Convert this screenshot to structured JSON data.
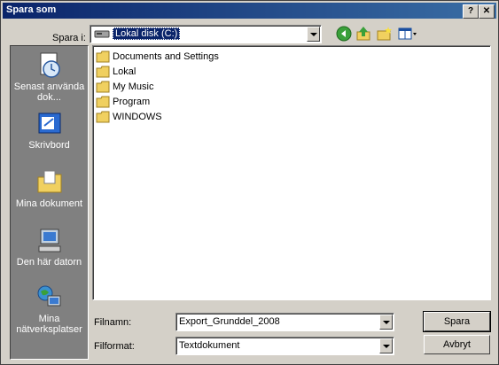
{
  "window": {
    "title": "Spara som",
    "help_label": "?",
    "close_label": "✕"
  },
  "save_in": {
    "label": "Spara i:",
    "value": "Lokal disk (C:)"
  },
  "places": [
    {
      "label": "Senast använda dok...",
      "icon": "recent-documents-icon"
    },
    {
      "label": "Skrivbord",
      "icon": "desktop-icon"
    },
    {
      "label": "Mina dokument",
      "icon": "my-documents-icon"
    },
    {
      "label": "Den här datorn",
      "icon": "my-computer-icon"
    },
    {
      "label": "Mina nätverksplatser",
      "icon": "network-places-icon"
    }
  ],
  "files": [
    {
      "name": "Documents and Settings"
    },
    {
      "name": "Lokal"
    },
    {
      "name": "My Music"
    },
    {
      "name": "Program"
    },
    {
      "name": "WINDOWS"
    }
  ],
  "filename": {
    "label": "Filnamn:",
    "value": "Export_Grunddel_2008"
  },
  "filetype": {
    "label": "Filformat:",
    "value": "Textdokument"
  },
  "buttons": {
    "save": "Spara",
    "cancel": "Avbryt"
  },
  "colors": {
    "titlebar": "#0a246a",
    "face": "#d4d0c8",
    "places_bg": "#808080",
    "folder": "#f0d060"
  }
}
